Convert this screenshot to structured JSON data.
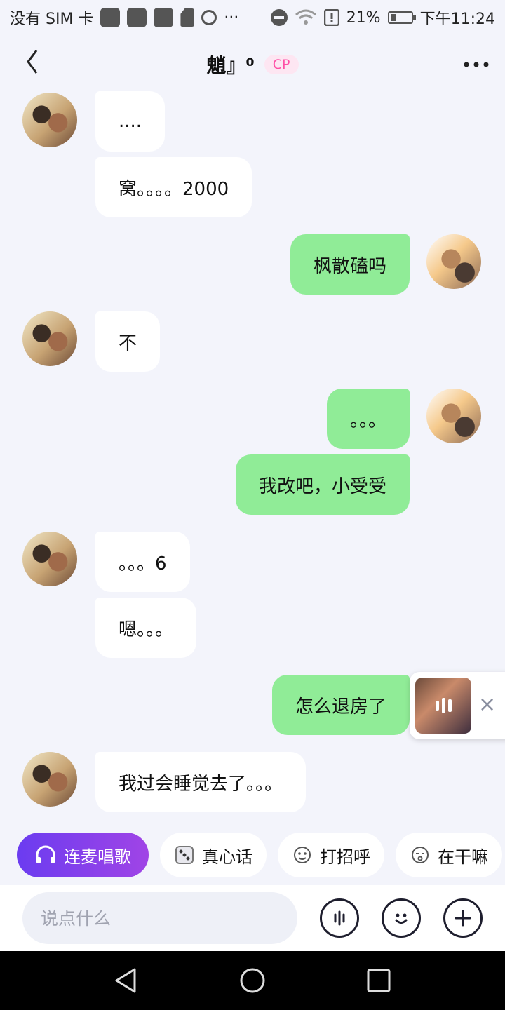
{
  "status_bar": {
    "carrier": "没有 SIM 卡",
    "overflow": "···",
    "battery": "21%",
    "time": "下午11:24"
  },
  "header": {
    "title": "魈』⁰",
    "badge": "CP"
  },
  "messages": [
    {
      "side": "in",
      "text": "....",
      "avatar": true
    },
    {
      "side": "in",
      "text": "窝。。。。2000",
      "avatar": false
    },
    {
      "side": "out",
      "text": "枫散磕吗",
      "avatar": true
    },
    {
      "side": "in",
      "text": "不",
      "avatar": true
    },
    {
      "side": "out",
      "text": "。。。",
      "avatar": true
    },
    {
      "side": "out",
      "text": "我改吧，小受受",
      "avatar": false
    },
    {
      "side": "in",
      "text": "。。。6",
      "avatar": true
    },
    {
      "side": "in",
      "text": "嗯。。。",
      "avatar": false
    },
    {
      "side": "out",
      "text": "怎么退房了",
      "avatar": false
    },
    {
      "side": "in",
      "text": "我过会睡觉去了。。。",
      "avatar": true
    }
  ],
  "float_widget": {
    "icon": "music-bars-icon",
    "close": "×"
  },
  "chips": [
    {
      "label": "连麦唱歌",
      "icon": "headphones-icon"
    },
    {
      "label": "真心话",
      "icon": "dice-icon"
    },
    {
      "label": "打招呼",
      "icon": "wave-face-icon"
    },
    {
      "label": "在干嘛",
      "icon": "curious-face-icon"
    }
  ],
  "input": {
    "placeholder": "说点什么"
  },
  "colors": {
    "outgoing": "#90ec97",
    "incoming": "#ffffff",
    "accent": "#7a3eec",
    "cp_badge": "#ff4fa6"
  }
}
